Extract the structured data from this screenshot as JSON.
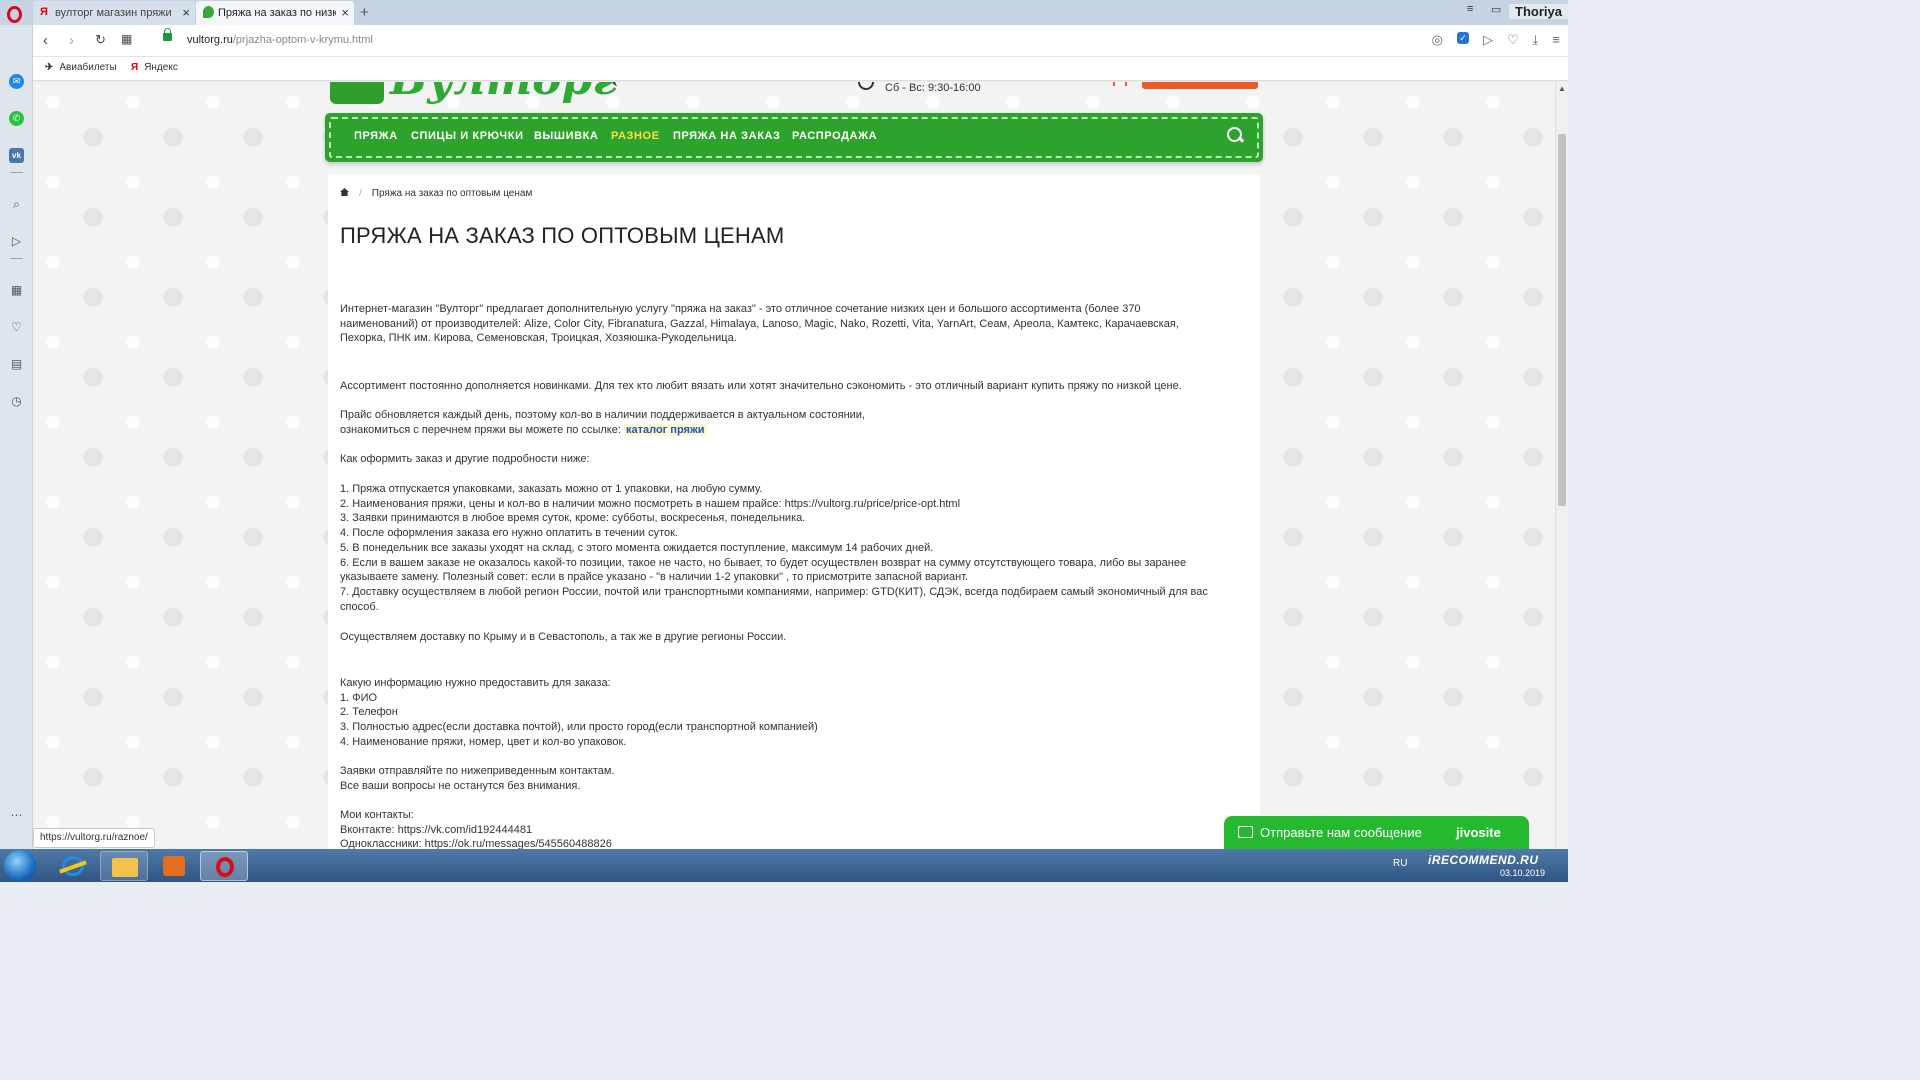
{
  "browser": {
    "tabs": [
      {
        "title": "вулторг магазин пряжи -",
        "icon": "yandex-icon"
      },
      {
        "title": "Пряжа на заказ по низки",
        "icon": "vultorg-leaf-icon"
      }
    ],
    "user_name": "Thoriya",
    "url_host": "vultorg.ru",
    "url_path": "/prjazha-optom-v-krymu.html",
    "bookmarks": [
      {
        "label": "Авиабилеты",
        "icon": "plane-icon"
      },
      {
        "label": "Яндекс",
        "icon": "yandex-icon"
      }
    ],
    "status_url": "https://vultorg.ru/raznoe/"
  },
  "site": {
    "hours": "Сб - Вс: 9:30-16:00",
    "nav": [
      {
        "label": "ПРЯЖА",
        "active": false
      },
      {
        "label": "СПИЦЫ И КРЮЧКИ",
        "active": false
      },
      {
        "label": "ВЫШИВКА",
        "active": false
      },
      {
        "label": "РАЗНОЕ",
        "active": true
      },
      {
        "label": "ПРЯЖА НА ЗАКАЗ",
        "active": false
      },
      {
        "label": "РАСПРОДАЖА",
        "active": false
      }
    ],
    "accent_color": "#2da22d",
    "active_nav_color": "#ffe13a"
  },
  "page": {
    "breadcrumb": "Пряжа на заказ по оптовым ценам",
    "title": "ПРЯЖА НА ЗАКАЗ ПО ОПТОВЫМ ЦЕНАМ",
    "intro": [
      "Интернет-магазин \"Вулторг\" предлагает дополнительную услугу \"пряжа на заказ\" - это отличное сочетание низких цен и большого ассортимента (более 370",
      "наименований) от производителей: Alize, Color City, Fibranatura, Gazzal, Himalaya, Lanoso, Magic, Nako, Rozetti, Vita, YarnArt, Сеам, Ареола, Камтекс, Карачаевская,",
      "Пехорка, ПНК им. Кирова, Семеновская, Троицкая, Хозяюшка-Рукодельница."
    ],
    "assortment": "Ассортимент постоянно дополняется новинками.  Для тех кто любит вязать или хотят значительно сэкономить - это отличный вариант купить пряжу по низкой цене.",
    "price_line_1": "Прайс обновляется каждый день, поэтому кол-во в наличии поддерживается в актуальном состоянии,",
    "price_line_2": "ознакомиться с перечнем пряжи вы можете по ссылке:",
    "catalog_link": "каталог пряжи",
    "how_to": "Как оформить заказ и другие подробности ниже:",
    "rules": [
      "1. Пряжа отпускается упаковками, заказать можно от 1 упаковки, на любую сумму.",
      "2. Наименования пряжи, цены и кол-во в наличии можно посмотреть в нашем прайсе: https://vultorg.ru/price/price-opt.html",
      "3. Заявки принимаются в любое время суток, кроме: субботы, воскресенья, понедельника.",
      "4. После оформления заказа его нужно оплатить в течении суток.",
      "5. В понедельник все заказы уходят на склад, с этого момента ожидается поступление, максимум 14 рабочих дней.",
      "6. Если в вашем заказе не оказалось какой-то позиции, такое не часто, но бывает, то будет осуществлен возврат на сумму отсутствующего товара, либо вы заранее",
      "указываете замену. Полезный совет: если в прайсе указано - \"в наличии 1-2 упаковки\" , то присмотрите запасной вариант.",
      "7. Доставку осуществляем в любой регион России, почтой или транспортными компаниями, например: GTD(КИТ), СДЭК, всегда подбираем самый экономичный для вас",
      "способ."
    ],
    "delivery": "Осуществляем доставку по Крыму и в Севастополь, а так же в другие регионы России.",
    "info_title": "Какую информацию нужно предоставить для заказа:",
    "info_items": [
      "1. ФИО",
      "2. Телефон",
      "3. Полностью адрес(если доставка почтой), или просто город(если транспортной компанией)",
      "4. Наименование пряжи, номер, цвет и кол-во упаковок."
    ],
    "send_1": "Заявки отправляйте по нижеприведенным контактам.",
    "send_2": "Все ваши вопросы не останутся без внимания.",
    "contacts_title": "Мои контакты:",
    "contact_vk": "Вконтакте: https://vk.com/id192444481",
    "contact_ok": "Одноклассники: https://ok.ru/messages/545560488826"
  },
  "chat": {
    "label": "Отправьте нам сообщение",
    "brand": "jivosite"
  },
  "taskbar": {
    "lang": "RU",
    "watermark": "iRECOMMEND.RU",
    "date": "03.10.2019"
  }
}
